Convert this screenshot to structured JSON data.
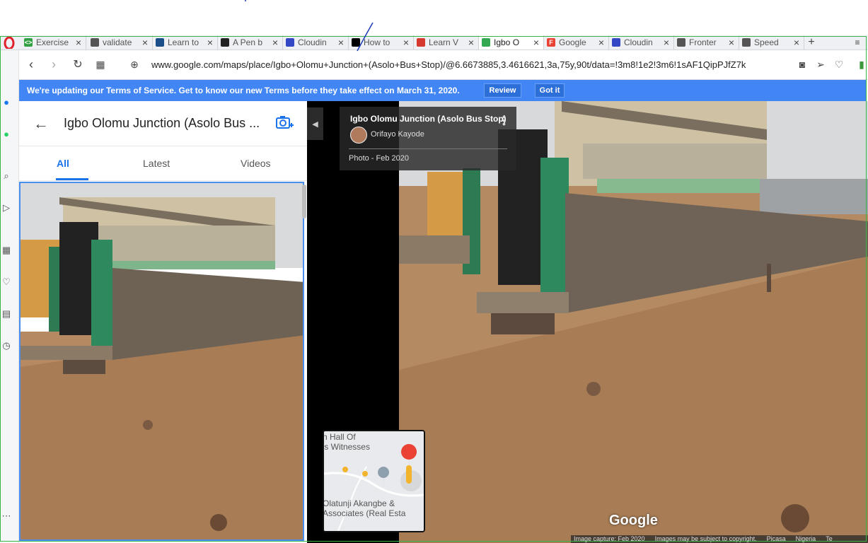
{
  "browser": {
    "tabs": [
      {
        "label": "Exercise",
        "fav_color": "#35a043",
        "fav_text": "<>",
        "active": false
      },
      {
        "label": "validate",
        "fav_color": "#555555",
        "fav_text": "",
        "active": false
      },
      {
        "label": "Learn to",
        "fav_color": "#1b4f8a",
        "fav_text": "",
        "active": false
      },
      {
        "label": "A Pen b",
        "fav_color": "#222222",
        "fav_text": "",
        "active": false
      },
      {
        "label": "Cloudin",
        "fav_color": "#3448c5",
        "fav_text": "",
        "active": false
      },
      {
        "label": "How to",
        "fav_color": "#000000",
        "fav_text": "",
        "active": false
      },
      {
        "label": "Learn V",
        "fav_color": "#d63a2f",
        "fav_text": "",
        "active": false
      },
      {
        "label": "Igbo O",
        "fav_color": "#34a853",
        "fav_text": "",
        "active": true
      },
      {
        "label": "Google",
        "fav_color": "#ea4335",
        "fav_text": "F",
        "active": false
      },
      {
        "label": "Cloudin",
        "fav_color": "#3448c5",
        "fav_text": "",
        "active": false
      },
      {
        "label": "Fronter",
        "fav_color": "#555555",
        "fav_text": "",
        "active": false
      },
      {
        "label": "Speed",
        "fav_color": "#555555",
        "fav_text": "",
        "active": false
      }
    ],
    "url": "www.google.com/maps/place/Igbo+Olomu+Junction+(Asolo+Bus+Stop)/@6.6673885,3.4616621,3a,75y,90t/data=!3m8!1e2!3m6!1sAF1QipPJfZ7k"
  },
  "banner": {
    "text": "We're updating our Terms of Service. Get to know our new Terms before they take effect on March 31, 2020.",
    "review_label": "Review",
    "gotit_label": "Got it"
  },
  "panel": {
    "title": "Igbo Olomu Junction (Asolo Bus ...",
    "tabs": [
      "All",
      "Latest",
      "Videos"
    ],
    "active_tab": "All"
  },
  "viewer": {
    "place_name": "Igbo Olomu Junction (Asolo Bus Stop)",
    "author": "Orifayo Kayode",
    "photo_date": "Photo - Feb 2020",
    "watermark": "Google",
    "footer": [
      "Image capture: Feb 2020",
      "Images may be subject to copyright.",
      "Picasa",
      "Nigeria",
      "Te"
    ]
  },
  "minimap": {
    "label_top_1": "n Hall Of",
    "label_top_2": "'s Witnesses",
    "label_bottom_1": "Olatunji Akangbe &",
    "label_bottom_2": "Associates (Real Esta",
    "marker_color": "#ea4335"
  }
}
